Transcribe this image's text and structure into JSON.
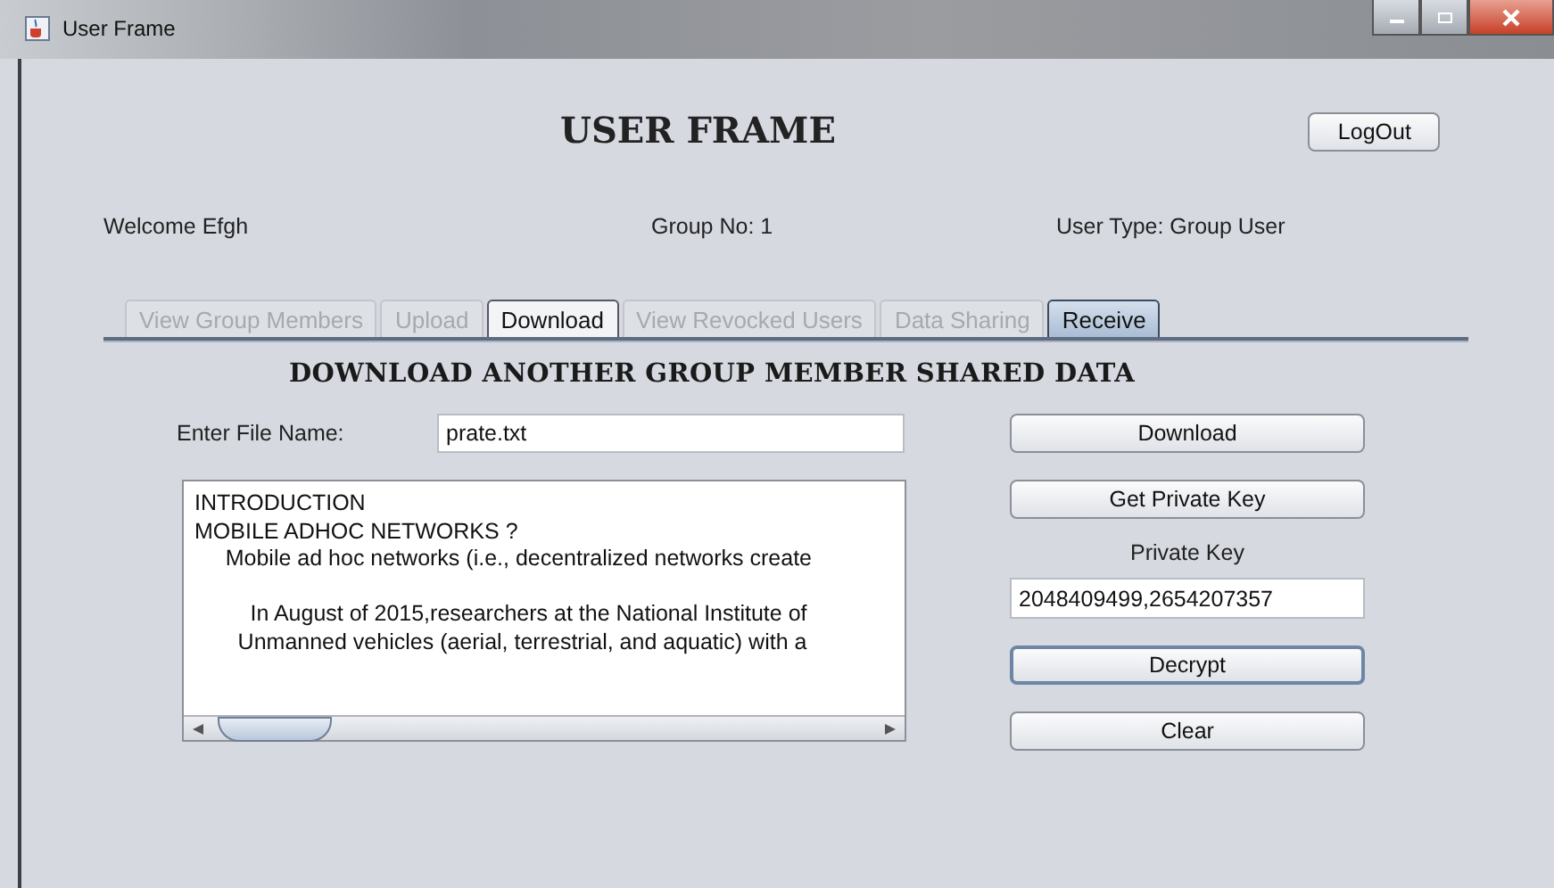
{
  "window": {
    "title": "User Frame"
  },
  "header": {
    "title": "USER FRAME",
    "logout_button": "LogOut"
  },
  "info": {
    "welcome": "Welcome Efgh",
    "group": "Group No: 1",
    "user_type": "User Type: Group User"
  },
  "tabs": [
    {
      "label": "View Group Members",
      "selected": false,
      "disabled": true
    },
    {
      "label": "Upload",
      "selected": false,
      "disabled": true
    },
    {
      "label": "Download",
      "selected": false,
      "disabled": false
    },
    {
      "label": "View Revocked Users",
      "selected": false,
      "disabled": true
    },
    {
      "label": "Data Sharing",
      "selected": false,
      "disabled": true
    },
    {
      "label": "Receive",
      "selected": true,
      "disabled": false
    }
  ],
  "panel": {
    "heading": "DOWNLOAD ANOTHER GROUP MEMBER SHARED DATA",
    "file_label": "Enter File Name:",
    "file_value": "prate.txt",
    "content_paragraphs": [
      [
        "INTRODUCTION",
        "MOBILE ADHOC NETWORKS ?",
        "     Mobile ad hoc networks (i.e., decentralized networks create"
      ],
      [
        "         In August of 2015,researchers at the National Institute of",
        "       Unmanned vehicles (aerial, terrestrial, and aquatic) with a"
      ]
    ],
    "download_button": "Download",
    "private_key_button": "Get Private Key",
    "private_key_label": "Private Key",
    "private_key_value": "2048409499,2654207357",
    "decrypt_button": "Decrypt",
    "clear_button": "Clear"
  }
}
